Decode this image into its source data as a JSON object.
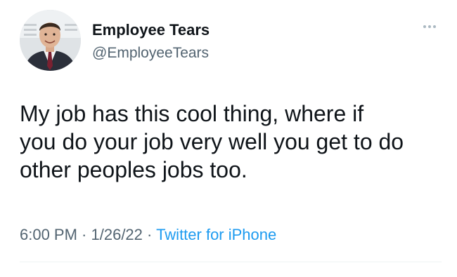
{
  "author": {
    "name": "Employee Tears",
    "handle": "@EmployeeTears",
    "avatar_icon": "profile-photo-man-in-suit"
  },
  "menu": {
    "icon": "more-dots-icon"
  },
  "tweet": {
    "lines": [
      "My job has this cool thing, where if",
      "you do your job very well you get to do",
      "other peoples jobs too."
    ]
  },
  "meta": {
    "time": "6:00 PM",
    "separator": " · ",
    "date": "1/26/22",
    "source": "Twitter for iPhone"
  },
  "colors": {
    "text": "#0f1419",
    "secondary": "#536471",
    "link": "#1d9bf0"
  }
}
